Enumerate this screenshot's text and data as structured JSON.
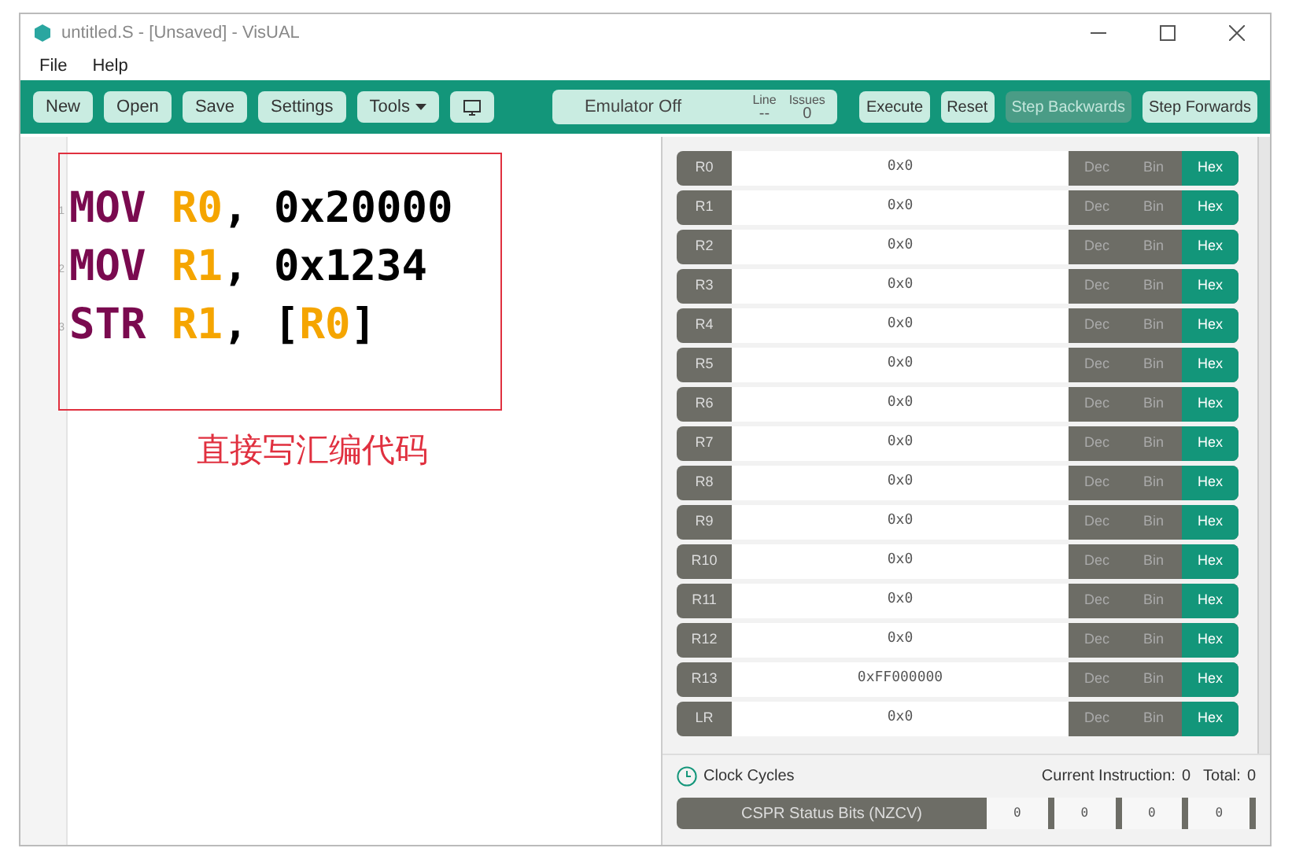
{
  "window": {
    "title": "untitled.S - [Unsaved] - VisUAL"
  },
  "menu": [
    "File",
    "Help"
  ],
  "toolbar": {
    "buttons": [
      {
        "label": "New",
        "kind": "button"
      },
      {
        "label": "Open",
        "kind": "button"
      },
      {
        "label": "Save",
        "kind": "button"
      },
      {
        "label": "Settings",
        "kind": "button"
      },
      {
        "label": "Tools",
        "kind": "dropdown"
      },
      {
        "kind": "icon"
      }
    ],
    "status": {
      "text": "Emulator Off",
      "line_label": "Line",
      "line_value": "--",
      "issues_label": "Issues",
      "issues_value": "0"
    },
    "actions": [
      {
        "label": "Execute",
        "disabled": false
      },
      {
        "label": "Reset",
        "disabled": false
      },
      {
        "label": "Step Backwards",
        "disabled": true
      },
      {
        "label": "Step Forwards",
        "disabled": false
      }
    ]
  },
  "editor": {
    "lines": [
      {
        "number": "1",
        "tokens": [
          {
            "text": "MOV",
            "kind": "op"
          },
          {
            "text": "R0",
            "kind": "reg"
          },
          {
            "text": ", 0x20000",
            "kind": "plain"
          }
        ]
      },
      {
        "number": "2",
        "tokens": [
          {
            "text": "MOV",
            "kind": "op"
          },
          {
            "text": "R1",
            "kind": "reg"
          },
          {
            "text": ", 0x1234",
            "kind": "plain"
          }
        ]
      },
      {
        "number": "3",
        "tokens": [
          {
            "text": "STR",
            "kind": "op"
          },
          {
            "text": "R1",
            "kind": "reg"
          },
          {
            "text": ", [",
            "kind": "plain"
          },
          {
            "text": "R0",
            "kind": "reg"
          },
          {
            "text": "]",
            "kind": "plain"
          }
        ]
      }
    ],
    "annotation": "直接写汇编代码"
  },
  "registers": [
    {
      "name": "R0",
      "value": "0x0",
      "formats": [
        {
          "label": "Dec",
          "selected": false
        },
        {
          "label": "Bin",
          "selected": false
        },
        {
          "label": "Hex",
          "selected": true
        }
      ]
    },
    {
      "name": "R1",
      "value": "0x0",
      "formats": [
        {
          "label": "Dec",
          "selected": false
        },
        {
          "label": "Bin",
          "selected": false
        },
        {
          "label": "Hex",
          "selected": true
        }
      ]
    },
    {
      "name": "R2",
      "value": "0x0",
      "formats": [
        {
          "label": "Dec",
          "selected": false
        },
        {
          "label": "Bin",
          "selected": false
        },
        {
          "label": "Hex",
          "selected": true
        }
      ]
    },
    {
      "name": "R3",
      "value": "0x0",
      "formats": [
        {
          "label": "Dec",
          "selected": false
        },
        {
          "label": "Bin",
          "selected": false
        },
        {
          "label": "Hex",
          "selected": true
        }
      ]
    },
    {
      "name": "R4",
      "value": "0x0",
      "formats": [
        {
          "label": "Dec",
          "selected": false
        },
        {
          "label": "Bin",
          "selected": false
        },
        {
          "label": "Hex",
          "selected": true
        }
      ]
    },
    {
      "name": "R5",
      "value": "0x0",
      "formats": [
        {
          "label": "Dec",
          "selected": false
        },
        {
          "label": "Bin",
          "selected": false
        },
        {
          "label": "Hex",
          "selected": true
        }
      ]
    },
    {
      "name": "R6",
      "value": "0x0",
      "formats": [
        {
          "label": "Dec",
          "selected": false
        },
        {
          "label": "Bin",
          "selected": false
        },
        {
          "label": "Hex",
          "selected": true
        }
      ]
    },
    {
      "name": "R7",
      "value": "0x0",
      "formats": [
        {
          "label": "Dec",
          "selected": false
        },
        {
          "label": "Bin",
          "selected": false
        },
        {
          "label": "Hex",
          "selected": true
        }
      ]
    },
    {
      "name": "R8",
      "value": "0x0",
      "formats": [
        {
          "label": "Dec",
          "selected": false
        },
        {
          "label": "Bin",
          "selected": false
        },
        {
          "label": "Hex",
          "selected": true
        }
      ]
    },
    {
      "name": "R9",
      "value": "0x0",
      "formats": [
        {
          "label": "Dec",
          "selected": false
        },
        {
          "label": "Bin",
          "selected": false
        },
        {
          "label": "Hex",
          "selected": true
        }
      ]
    },
    {
      "name": "R10",
      "value": "0x0",
      "formats": [
        {
          "label": "Dec",
          "selected": false
        },
        {
          "label": "Bin",
          "selected": false
        },
        {
          "label": "Hex",
          "selected": true
        }
      ]
    },
    {
      "name": "R11",
      "value": "0x0",
      "formats": [
        {
          "label": "Dec",
          "selected": false
        },
        {
          "label": "Bin",
          "selected": false
        },
        {
          "label": "Hex",
          "selected": true
        }
      ]
    },
    {
      "name": "R12",
      "value": "0x0",
      "formats": [
        {
          "label": "Dec",
          "selected": false
        },
        {
          "label": "Bin",
          "selected": false
        },
        {
          "label": "Hex",
          "selected": true
        }
      ]
    },
    {
      "name": "R13",
      "value": "0xFF000000",
      "formats": [
        {
          "label": "Dec",
          "selected": false
        },
        {
          "label": "Bin",
          "selected": false
        },
        {
          "label": "Hex",
          "selected": true
        }
      ]
    },
    {
      "name": "LR",
      "value": "0x0",
      "formats": [
        {
          "label": "Dec",
          "selected": false
        },
        {
          "label": "Bin",
          "selected": false
        },
        {
          "label": "Hex",
          "selected": true
        }
      ]
    }
  ],
  "clock": {
    "label": "Clock Cycles",
    "current_label": "Current Instruction:",
    "current_value": "0",
    "total_label": "Total:",
    "total_value": "0"
  },
  "status_bits": {
    "label": "CSPR Status Bits (NZCV)",
    "bits": [
      "0",
      "0",
      "0",
      "0"
    ]
  }
}
